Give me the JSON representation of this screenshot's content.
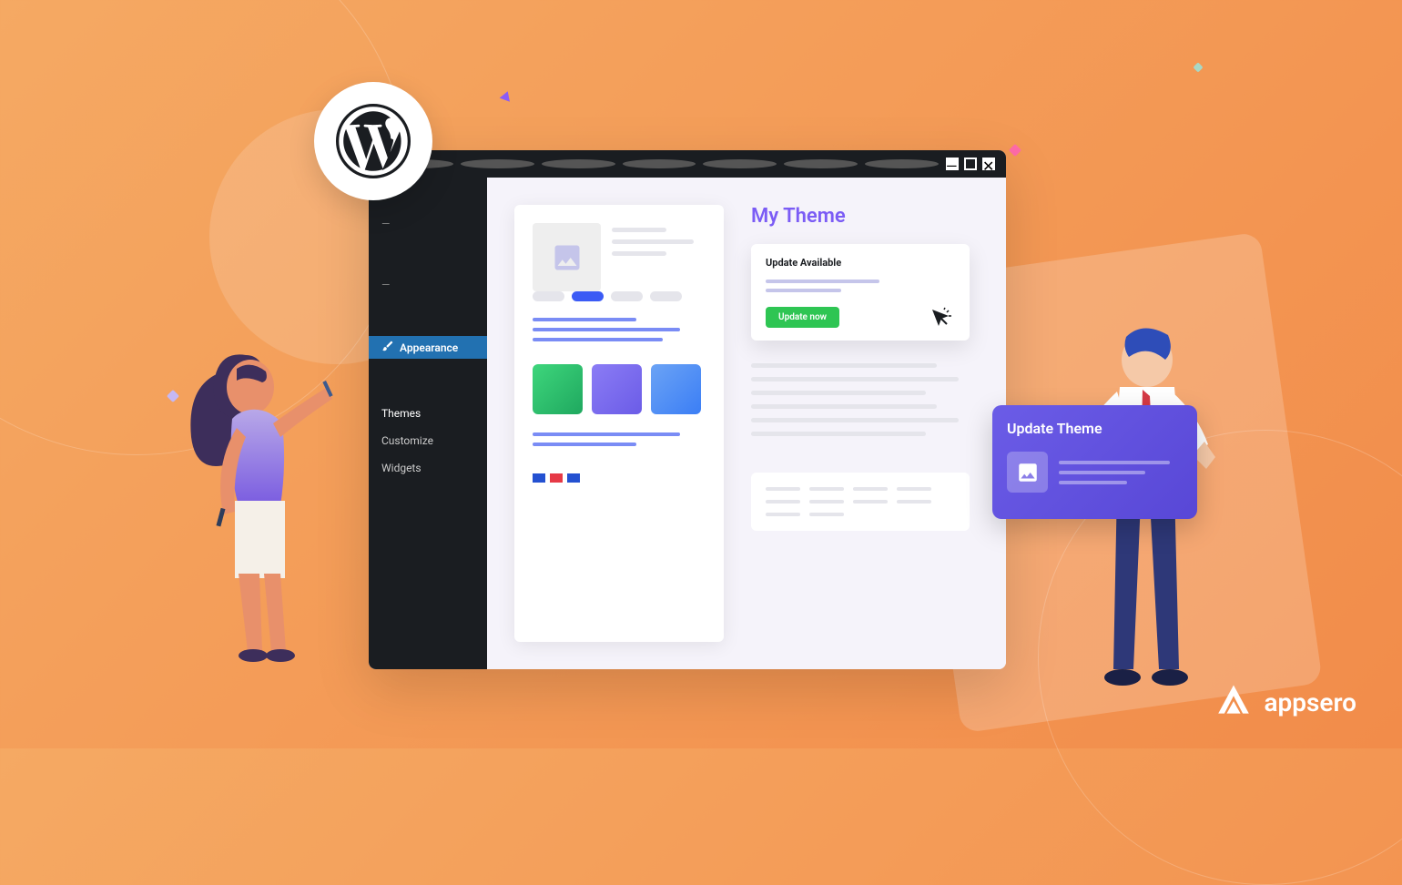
{
  "sidebar": {
    "appearance_label": "Appearance",
    "themes_label": "Themes",
    "customize_label": "Customize",
    "widgets_label": "Widgets"
  },
  "content": {
    "theme_title": "My Theme",
    "update_available_label": "Update Available",
    "update_button_label": "Update now"
  },
  "update_card": {
    "title": "Update Theme"
  },
  "brand": {
    "name": "appsero"
  }
}
